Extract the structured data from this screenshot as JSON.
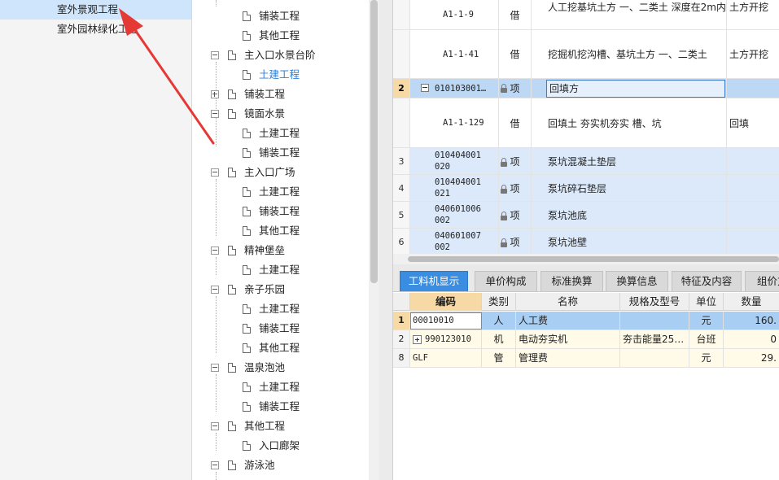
{
  "project_list": {
    "items": [
      {
        "label": "室外景观工程",
        "selected": true
      },
      {
        "label": "室外园林绿化工程",
        "selected": false
      }
    ]
  },
  "tree": {
    "nodes": [
      {
        "label": "铺装工程"
      },
      {
        "label": "其他工程"
      },
      {
        "label": "主入口水景台阶"
      },
      {
        "label": "土建工程"
      },
      {
        "label": "铺装工程"
      },
      {
        "label": "镜面水景"
      },
      {
        "label": "土建工程"
      },
      {
        "label": "铺装工程"
      },
      {
        "label": "主入口广场"
      },
      {
        "label": "土建工程"
      },
      {
        "label": "铺装工程"
      },
      {
        "label": "其他工程"
      },
      {
        "label": "精神堡垒"
      },
      {
        "label": "土建工程"
      },
      {
        "label": "亲子乐园"
      },
      {
        "label": "土建工程"
      },
      {
        "label": "铺装工程"
      },
      {
        "label": "其他工程"
      },
      {
        "label": "温泉泡池"
      },
      {
        "label": "土建工程"
      },
      {
        "label": "铺装工程"
      },
      {
        "label": "其他工程"
      },
      {
        "label": "入口廊架"
      },
      {
        "label": "游泳池"
      }
    ]
  },
  "upper_grid": {
    "rows": [
      {
        "num": "",
        "code": "A1-1-9",
        "type": "借",
        "name": "人工挖基坑土方 一、二类土 深度在2m内",
        "feature": "土方开挖"
      },
      {
        "num": "",
        "code": "A1-1-41",
        "type": "借",
        "name": "挖掘机挖沟槽、基坑土方 一、二类土",
        "feature": "土方开挖"
      },
      {
        "num": "2",
        "code": "010103001…",
        "type": "项",
        "name": "回填方",
        "feature": ""
      },
      {
        "num": "",
        "code": "A1-1-129",
        "type": "借",
        "name": "回填土 夯实机夯实 槽、坑",
        "feature": "回填"
      },
      {
        "num": "3",
        "code": "010404001020",
        "type": "项",
        "name": "泵坑混凝土垫层",
        "feature": ""
      },
      {
        "num": "4",
        "code": "010404001021",
        "type": "项",
        "name": "泵坑碎石垫层",
        "feature": ""
      },
      {
        "num": "5",
        "code": "040601006002",
        "type": "项",
        "name": "泵坑池底",
        "feature": ""
      },
      {
        "num": "6",
        "code": "040601007002",
        "type": "项",
        "name": "泵坑池壁",
        "feature": ""
      }
    ]
  },
  "lower_panel": {
    "tabs": [
      "工料机显示",
      "单价构成",
      "标准换算",
      "换算信息",
      "特征及内容",
      "组价方"
    ],
    "columns": [
      "编码",
      "类别",
      "名称",
      "规格及型号",
      "单位",
      "数量"
    ],
    "rows": [
      {
        "num": "1",
        "code": "00010010",
        "cat": "人",
        "name": "人工费",
        "spec": "",
        "unit": "元",
        "qty": "160."
      },
      {
        "num": "2",
        "code": "990123010",
        "cat": "机",
        "name": "电动夯实机",
        "spec": "夯击能量25…",
        "unit": "台班",
        "qty": "0"
      },
      {
        "num": "8",
        "code": "GLF",
        "cat": "管",
        "name": "管理费",
        "spec": "",
        "unit": "元",
        "qty": "29."
      }
    ]
  },
  "colors": {
    "accent": "#3a8de0",
    "selected_row": "#bcd8f5",
    "annotation": "#e53935"
  }
}
